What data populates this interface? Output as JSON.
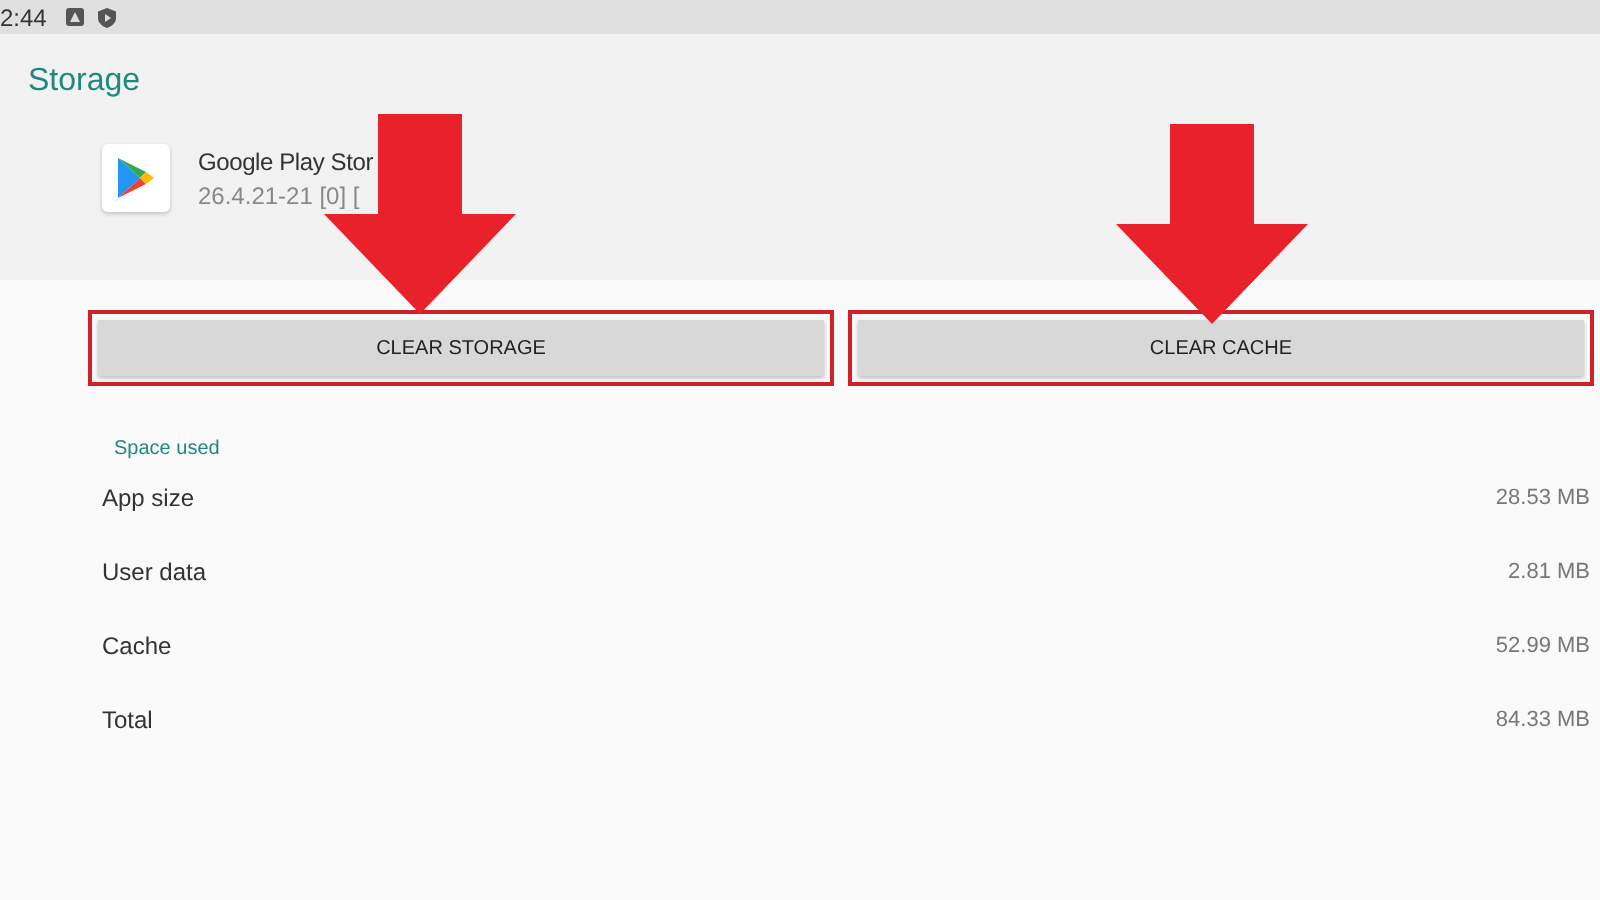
{
  "status_bar": {
    "time": "2:44"
  },
  "title": "Storage",
  "app": {
    "name": "Google Play Stor",
    "version": "26.4.21-21 [0] ["
  },
  "buttons": [
    {
      "label": "CLEAR STORAGE",
      "highlighted": true
    },
    {
      "label": "CLEAR CACHE",
      "highlighted": true
    }
  ],
  "section": "Space used",
  "rows": [
    {
      "label": "App size",
      "value": "28.53 MB"
    },
    {
      "label": "User data",
      "value": "2.81 MB"
    },
    {
      "label": "Cache",
      "value": "52.99 MB"
    },
    {
      "label": "Total",
      "value": "84.33 MB"
    }
  ]
}
